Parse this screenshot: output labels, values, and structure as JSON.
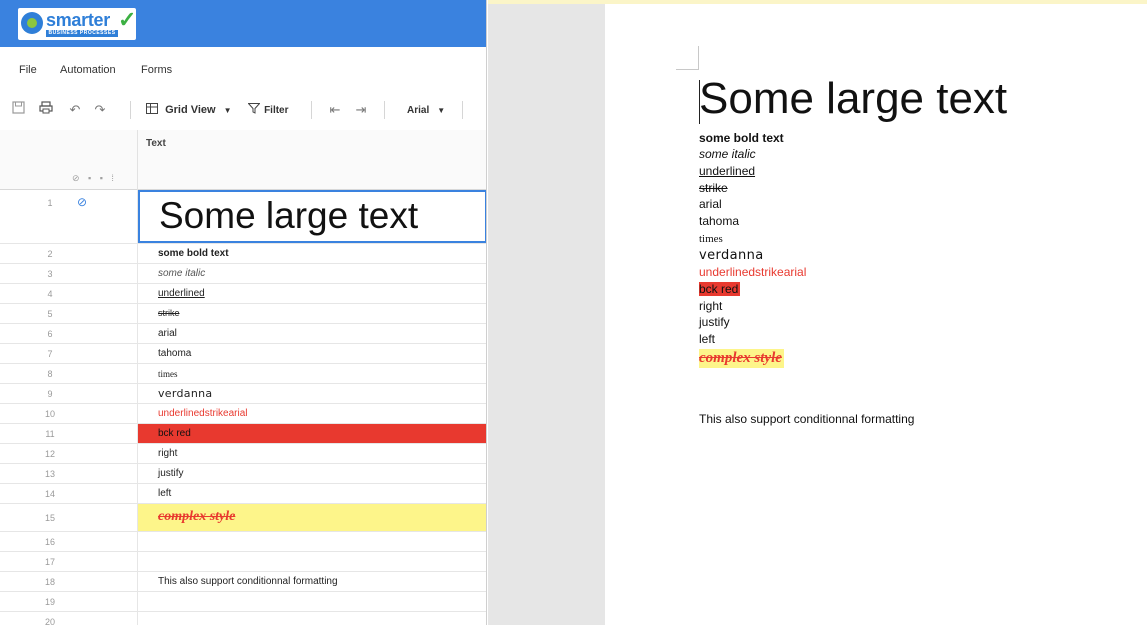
{
  "app": {
    "logo_text": "smarter",
    "logo_subtext": "BUSINESS PROCESSES",
    "menu": [
      "File",
      "Automation",
      "Forms"
    ],
    "toolbar": {
      "view_label": "Grid View",
      "filter_label": "Filter",
      "font_label": "Arial"
    },
    "grid": {
      "column_header": "Text",
      "rows": [
        {
          "num": "1",
          "text": "Some large text"
        },
        {
          "num": "2",
          "text": "some bold text"
        },
        {
          "num": "3",
          "text": "some italic"
        },
        {
          "num": "4",
          "text": "underlined"
        },
        {
          "num": "5",
          "text": "strike"
        },
        {
          "num": "6",
          "text": "arial"
        },
        {
          "num": "7",
          "text": "tahoma"
        },
        {
          "num": "8",
          "text": "times"
        },
        {
          "num": "9",
          "text": "verdanna"
        },
        {
          "num": "10",
          "text": "underlinedstrikearial"
        },
        {
          "num": "11",
          "text": "bck red"
        },
        {
          "num": "12",
          "text": "right"
        },
        {
          "num": "13",
          "text": "justify"
        },
        {
          "num": "14",
          "text": "left"
        },
        {
          "num": "15",
          "text": "complex style"
        },
        {
          "num": "16",
          "text": ""
        },
        {
          "num": "17",
          "text": ""
        },
        {
          "num": "18",
          "text": "This also support conditionnal formatting"
        },
        {
          "num": "19",
          "text": ""
        },
        {
          "num": "20",
          "text": ""
        }
      ]
    }
  },
  "document": {
    "large": "Some large text",
    "lines": [
      "some bold text",
      "some italic",
      "underlined",
      "strike",
      "arial",
      "tahoma",
      "times",
      "verdanna",
      "underlinedstrikearial",
      "bck red",
      "right",
      "justify",
      "left",
      "complex style"
    ],
    "footer": "This also support conditionnal formatting"
  },
  "colors": {
    "header_blue": "#3a82df",
    "highlight_red": "#e8392f",
    "highlight_yellow": "#fdf58a",
    "text_red": "#e8392f"
  }
}
